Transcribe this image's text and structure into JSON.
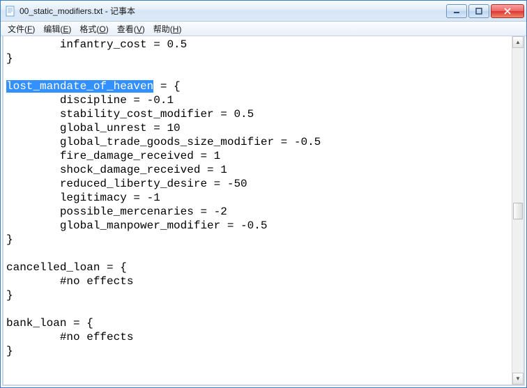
{
  "window": {
    "title": "00_static_modifiers.txt - 记事本"
  },
  "menu": {
    "file": {
      "label": "文件",
      "hotkey": "F"
    },
    "edit": {
      "label": "编辑",
      "hotkey": "E"
    },
    "format": {
      "label": "格式",
      "hotkey": "O"
    },
    "view": {
      "label": "查看",
      "hotkey": "V"
    },
    "help": {
      "label": "帮助",
      "hotkey": "H"
    }
  },
  "editor": {
    "selected_text": "lost_mandate_of_heaven",
    "lines_pre": [
      "        infantry_cost = 0.5",
      "}",
      "",
      ""
    ],
    "sel_line_suffix": " = {",
    "lines_post": [
      "        discipline = -0.1",
      "        stability_cost_modifier = 0.5",
      "        global_unrest = 10",
      "        global_trade_goods_size_modifier = -0.5",
      "        fire_damage_received = 1",
      "        shock_damage_received = 1",
      "        reduced_liberty_desire = -50",
      "        legitimacy = -1",
      "        possible_mercenaries = -2",
      "        global_manpower_modifier = -0.5",
      "}",
      "",
      "cancelled_loan = {",
      "        #no effects",
      "}",
      "",
      "bank_loan = {",
      "        #no effects",
      "}",
      ""
    ]
  }
}
